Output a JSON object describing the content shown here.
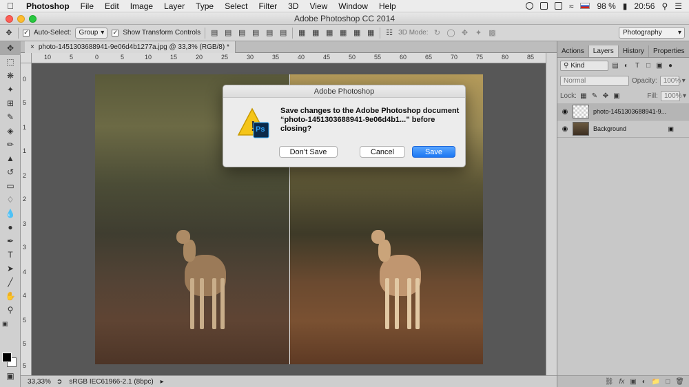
{
  "menubar": {
    "app": "Photoshop",
    "items": [
      "File",
      "Edit",
      "Image",
      "Layer",
      "Type",
      "Select",
      "Filter",
      "3D",
      "View",
      "Window",
      "Help"
    ],
    "battery": "98 %",
    "time": "20:56"
  },
  "window": {
    "title": "Adobe Photoshop CC 2014"
  },
  "options": {
    "auto_select_label": "Auto-Select:",
    "auto_select_value": "Group",
    "show_transform_label": "Show Transform Controls",
    "mode_3d_label": "3D Mode:",
    "workspace": "Photography"
  },
  "document": {
    "tab_label": "photo-1451303688941-9e06d4b1277a.jpg @ 33,3% (RGB/8) *",
    "ruler_h": [
      "10",
      "5",
      "0",
      "5",
      "10",
      "15",
      "20",
      "25",
      "30",
      "35",
      "40",
      "45",
      "50",
      "55",
      "60",
      "65",
      "70",
      "75",
      "80",
      "85"
    ],
    "ruler_v": [
      "0",
      "5",
      "1",
      "1",
      "2",
      "2",
      "3",
      "3",
      "4",
      "4",
      "5",
      "5",
      "5"
    ]
  },
  "dialog": {
    "title": "Adobe Photoshop",
    "message": "Save changes to the Adobe Photoshop document “photo-1451303688941-9e06d4b1...” before closing?",
    "dont_save": "Don’t Save",
    "cancel": "Cancel",
    "save": "Save",
    "icon_badge": "Ps"
  },
  "status": {
    "zoom": "33,33%",
    "profile": "sRGB IEC61966-2.1 (8bpc)"
  },
  "layers_panel": {
    "tabs": [
      "Actions",
      "Layers",
      "History",
      "Properties"
    ],
    "filter": "Kind",
    "blend_mode": "Normal",
    "opacity_label": "Opacity:",
    "opacity_value": "100%",
    "lock_label": "Lock:",
    "fill_label": "Fill:",
    "fill_value": "100%",
    "layers": [
      {
        "name": "photo-1451303688941-9...",
        "selected": true
      },
      {
        "name": "Background",
        "selected": false
      }
    ]
  },
  "colors": {
    "primary_button": "#1b77f2",
    "canvas_bg": "#575757",
    "panel_bg": "#c8c8c8"
  }
}
